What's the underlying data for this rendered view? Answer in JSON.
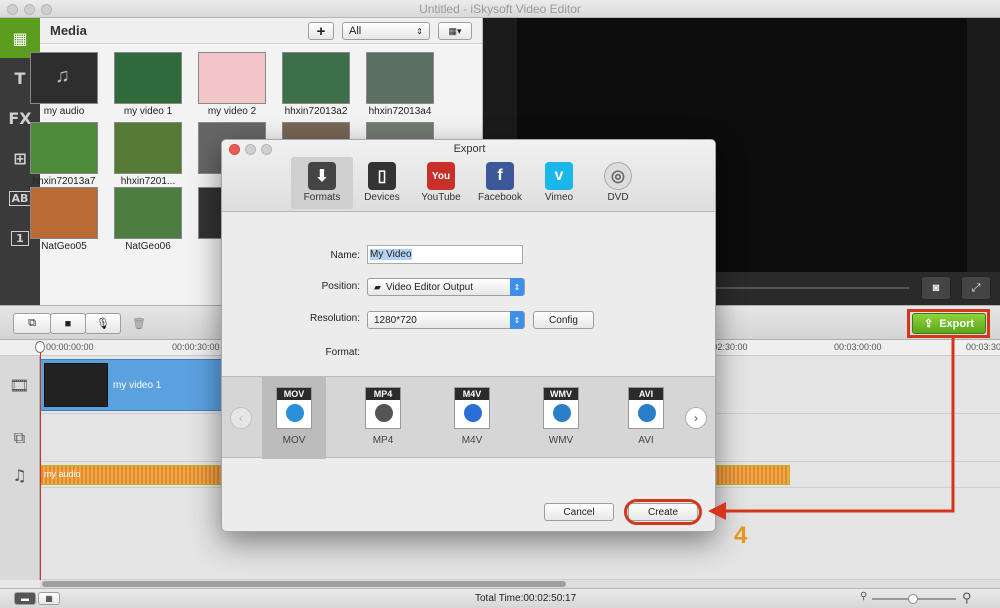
{
  "window": {
    "title": "Untitled - iSkysoft Video Editor"
  },
  "sidebar": {
    "items": [
      {
        "name": "media-icon",
        "glyph": "▦"
      },
      {
        "name": "text-icon",
        "glyph": "T"
      },
      {
        "name": "fx-icon",
        "glyph": "FX"
      },
      {
        "name": "transition-icon",
        "glyph": "⊞"
      },
      {
        "name": "overlay-icon",
        "glyph": "AB"
      },
      {
        "name": "intro-icon",
        "glyph": "1"
      }
    ]
  },
  "media": {
    "title": "Media",
    "add_label": "+",
    "filter_value": "All",
    "items": [
      {
        "label": "my audio",
        "color": "#2e2e2e"
      },
      {
        "label": "my video 1",
        "color": "#2f6a3a"
      },
      {
        "label": "my video 2",
        "color": "#f2c6c8"
      },
      {
        "label": "hhxin72013a2",
        "color": "#3d6f4a"
      },
      {
        "label": "hhxin72013a4",
        "color": "#5b6f63"
      },
      {
        "label": "hhxin72013a7",
        "color": "#4d8a3a"
      },
      {
        "label": "hhxin7201...",
        "color": "#567a35"
      },
      {
        "label": "",
        "color": "#666"
      },
      {
        "label": "",
        "color": "#776655"
      },
      {
        "label": "",
        "color": "#6f7a70"
      },
      {
        "label": "NatGeo05",
        "color": "#b96a35"
      },
      {
        "label": "NatGeo06",
        "color": "#4d7c40"
      },
      {
        "label": "",
        "color": "#333"
      },
      {
        "label": "",
        "color": "#1f4f8a"
      },
      {
        "label": "",
        "color": "#b04818"
      }
    ]
  },
  "timeline": {
    "times": [
      "00:00:00:00",
      "00:00:30:00",
      "00:02:30:00",
      "00:03:00:00",
      "00:03:30"
    ],
    "video_clip_label": "my video 1",
    "audio_clip_label": "my audio",
    "total_time": "Total Time:00:02:50:17",
    "export_label": "Export"
  },
  "dialog": {
    "title": "Export",
    "tabs": [
      {
        "label": "Formats",
        "icon": "formats-icon",
        "color": "#444"
      },
      {
        "label": "Devices",
        "icon": "devices-icon",
        "color": "#333"
      },
      {
        "label": "YouTube",
        "icon": "youtube-icon",
        "color": "#c9302c"
      },
      {
        "label": "Facebook",
        "icon": "facebook-icon",
        "color": "#3b5998"
      },
      {
        "label": "Vimeo",
        "icon": "vimeo-icon",
        "color": "#1ab7ea"
      },
      {
        "label": "DVD",
        "icon": "dvd-icon",
        "color": "#dcdcdc"
      }
    ],
    "active_tab": "Formats",
    "name_label": "Name:",
    "name_value": "My Video",
    "position_label": "Position:",
    "position_value": "Video Editor Output",
    "resolution_label": "Resolution:",
    "resolution_value": "1280*720",
    "config_label": "Config",
    "format_label": "Format:",
    "formats": [
      {
        "label": "MOV",
        "band": "MOV",
        "color": "#2a8fd8"
      },
      {
        "label": "MP4",
        "band": "MP4",
        "color": "#555"
      },
      {
        "label": "M4V",
        "band": "M4V",
        "color": "#2a6fd8"
      },
      {
        "label": "WMV",
        "band": "WMV",
        "color": "#2a7fc8"
      },
      {
        "label": "AVI",
        "band": "AVI",
        "color": "#2a7fc8"
      }
    ],
    "selected_format": "MOV",
    "cancel_label": "Cancel",
    "create_label": "Create"
  },
  "annotation": {
    "step": "4",
    "color": "#d3361a",
    "number_color": "#e8951a"
  }
}
